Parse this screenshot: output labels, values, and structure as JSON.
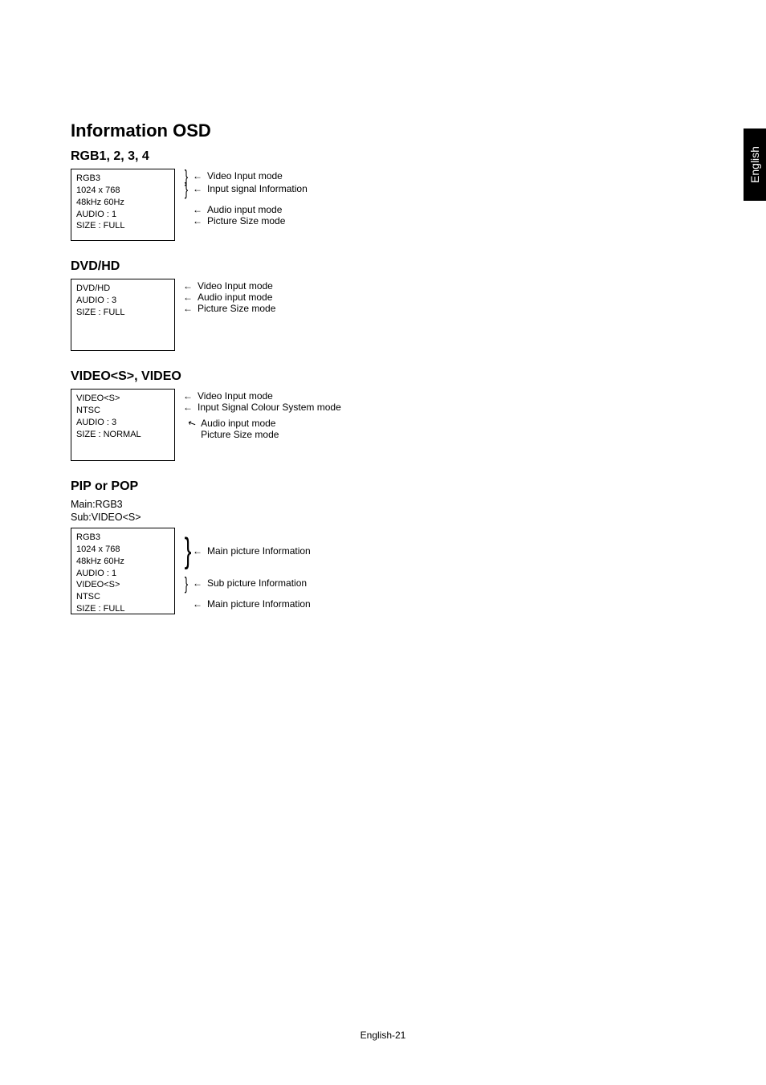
{
  "sideTab": "English",
  "footer": "English-21",
  "title": "Information OSD",
  "sections": {
    "rgb": {
      "heading": "RGB1, 2, 3, 4",
      "box": {
        "l1": "RGB3",
        "l2": "1024 x 768",
        "l3": "48kHz  60Hz",
        "l4": "AUDIO : 1",
        "l5": "SIZE : FULL"
      },
      "callouts": {
        "c1": "Video Input mode",
        "c2": "Input signal Information",
        "c3": "Audio input mode",
        "c4": "Picture Size mode"
      }
    },
    "dvd": {
      "heading": "DVD/HD",
      "box": {
        "l1": "DVD/HD",
        "l2": "AUDIO : 3",
        "l3": "SIZE : FULL"
      },
      "callouts": {
        "c1": "Video Input mode",
        "c2": "Audio input mode",
        "c3": "Picture Size mode"
      }
    },
    "video": {
      "heading": "VIDEO<S>, VIDEO",
      "box": {
        "l1": "VIDEO<S>",
        "l2": "NTSC",
        "l3": "AUDIO : 3",
        "l4": "SIZE : NORMAL"
      },
      "callouts": {
        "c1": "Video Input mode",
        "c2": "Input Signal Colour System mode",
        "c3": "Audio input mode",
        "c4": "Picture Size mode"
      }
    },
    "pip": {
      "heading": "PIP or POP",
      "sub1": "Main:RGB3",
      "sub2": "Sub:VIDEO<S>",
      "box": {
        "l1": "RGB3",
        "l2": "1024 x 768",
        "l3": "48kHz  60Hz",
        "l4": "AUDIO : 1",
        "l5": "VIDEO<S>",
        "l6": "NTSC",
        "l7": "SIZE : FULL"
      },
      "callouts": {
        "c1": "Main picture Information",
        "c2": "Sub picture Information",
        "c3": "Main picture Information"
      }
    }
  }
}
